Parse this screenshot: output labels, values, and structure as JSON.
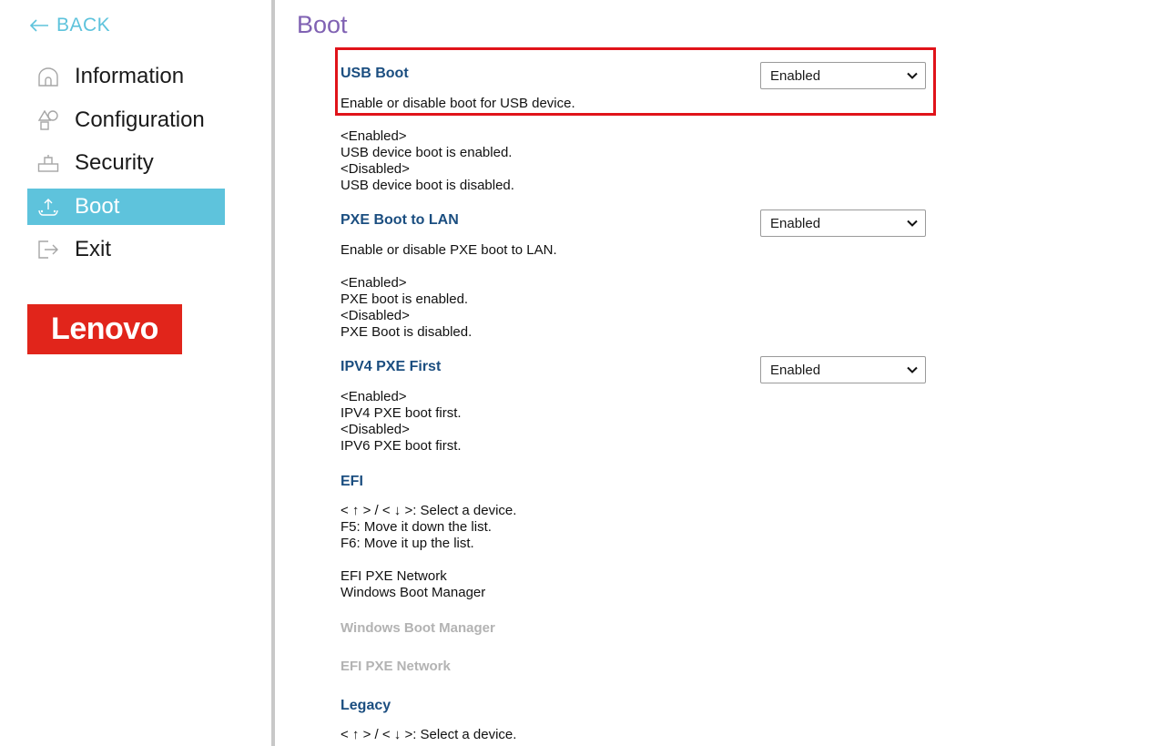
{
  "sidebar": {
    "back_label": "BACK",
    "items": [
      {
        "label": "Information",
        "icon": "home-icon"
      },
      {
        "label": "Configuration",
        "icon": "shapes-icon"
      },
      {
        "label": "Security",
        "icon": "security-icon"
      },
      {
        "label": "Boot",
        "icon": "boot-icon",
        "active": true
      },
      {
        "label": "Exit",
        "icon": "exit-icon"
      }
    ],
    "logo_text": "Lenovo"
  },
  "colors": {
    "accent": "#5ec3dc",
    "title": "#8062b3",
    "section": "#1b4e80",
    "logo": "#e1251b",
    "highlight": "#e0131a"
  },
  "main": {
    "title": "Boot",
    "usb_boot": {
      "title": "USB Boot",
      "value": "Enabled",
      "description": "Enable or disable boot for USB device.",
      "help": [
        "<Enabled>",
        "USB device boot is enabled.",
        "<Disabled>",
        "USB device boot is disabled."
      ]
    },
    "pxe_boot": {
      "title": "PXE Boot to LAN",
      "value": "Enabled",
      "description": "Enable or disable PXE boot to LAN.",
      "help": [
        "<Enabled>",
        "PXE boot is enabled.",
        "<Disabled>",
        "PXE Boot is disabled."
      ]
    },
    "ipv4_pxe": {
      "title": "IPV4 PXE First",
      "value": "Enabled",
      "help": [
        "<Enabled>",
        "IPV4 PXE boot first.",
        "<Disabled>",
        "IPV6 PXE boot first."
      ]
    },
    "efi": {
      "title": "EFI",
      "help": [
        "< ↑ > / < ↓ >: Select a device.",
        "F5: Move it down the list.",
        "F6: Move it up the list."
      ],
      "order": [
        "EFI PXE Network",
        "Windows Boot Manager"
      ],
      "devices": [
        "Windows Boot Manager",
        "EFI PXE Network"
      ]
    },
    "legacy": {
      "title": "Legacy",
      "help": [
        "< ↑ > / < ↓ >: Select a device."
      ]
    }
  }
}
